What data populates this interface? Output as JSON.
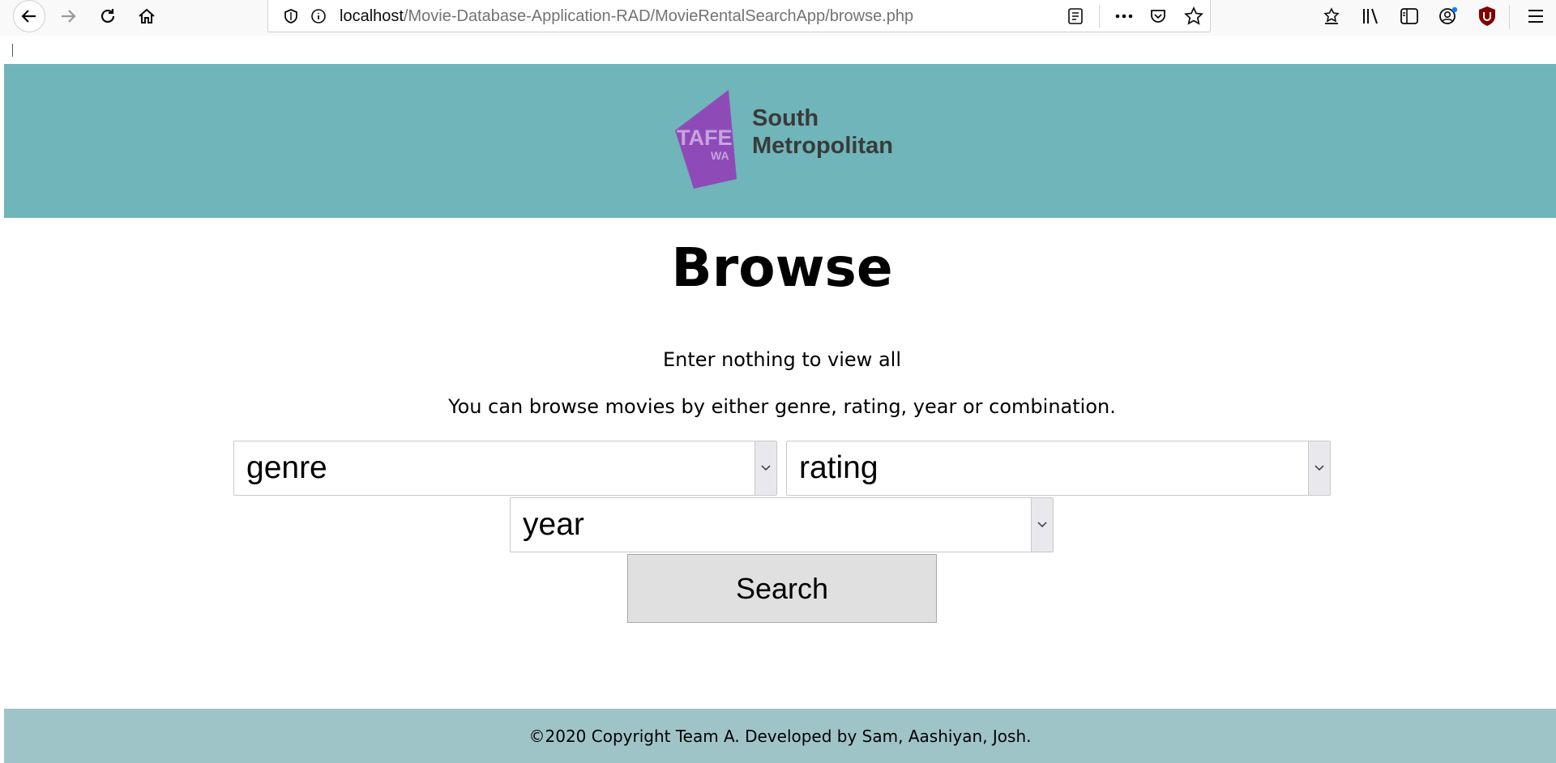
{
  "browser": {
    "url_host": "localhost",
    "url_path": "/Movie-Database-Application-RAD/MovieRentalSearchApp/browse.php"
  },
  "header": {
    "logo_text_line1": "South",
    "logo_text_line2": "Metropolitan",
    "logo_mark_text": "TAFE",
    "logo_mark_sub": "WA",
    "background": "#6fb5b9",
    "logo_color": "#8e4bb8"
  },
  "main": {
    "title": "Browse",
    "hint_all": "Enter nothing to view all",
    "hint_browse": "You can browse movies by either genre, rating, year or combination.",
    "filters": {
      "genre": "genre",
      "rating": "rating",
      "year": "year"
    },
    "search_label": "Search"
  },
  "footer": {
    "text": "©2020 Copyright Team A. Developed by Sam, Aashiyan, Josh.",
    "background": "#9fc4c8"
  }
}
